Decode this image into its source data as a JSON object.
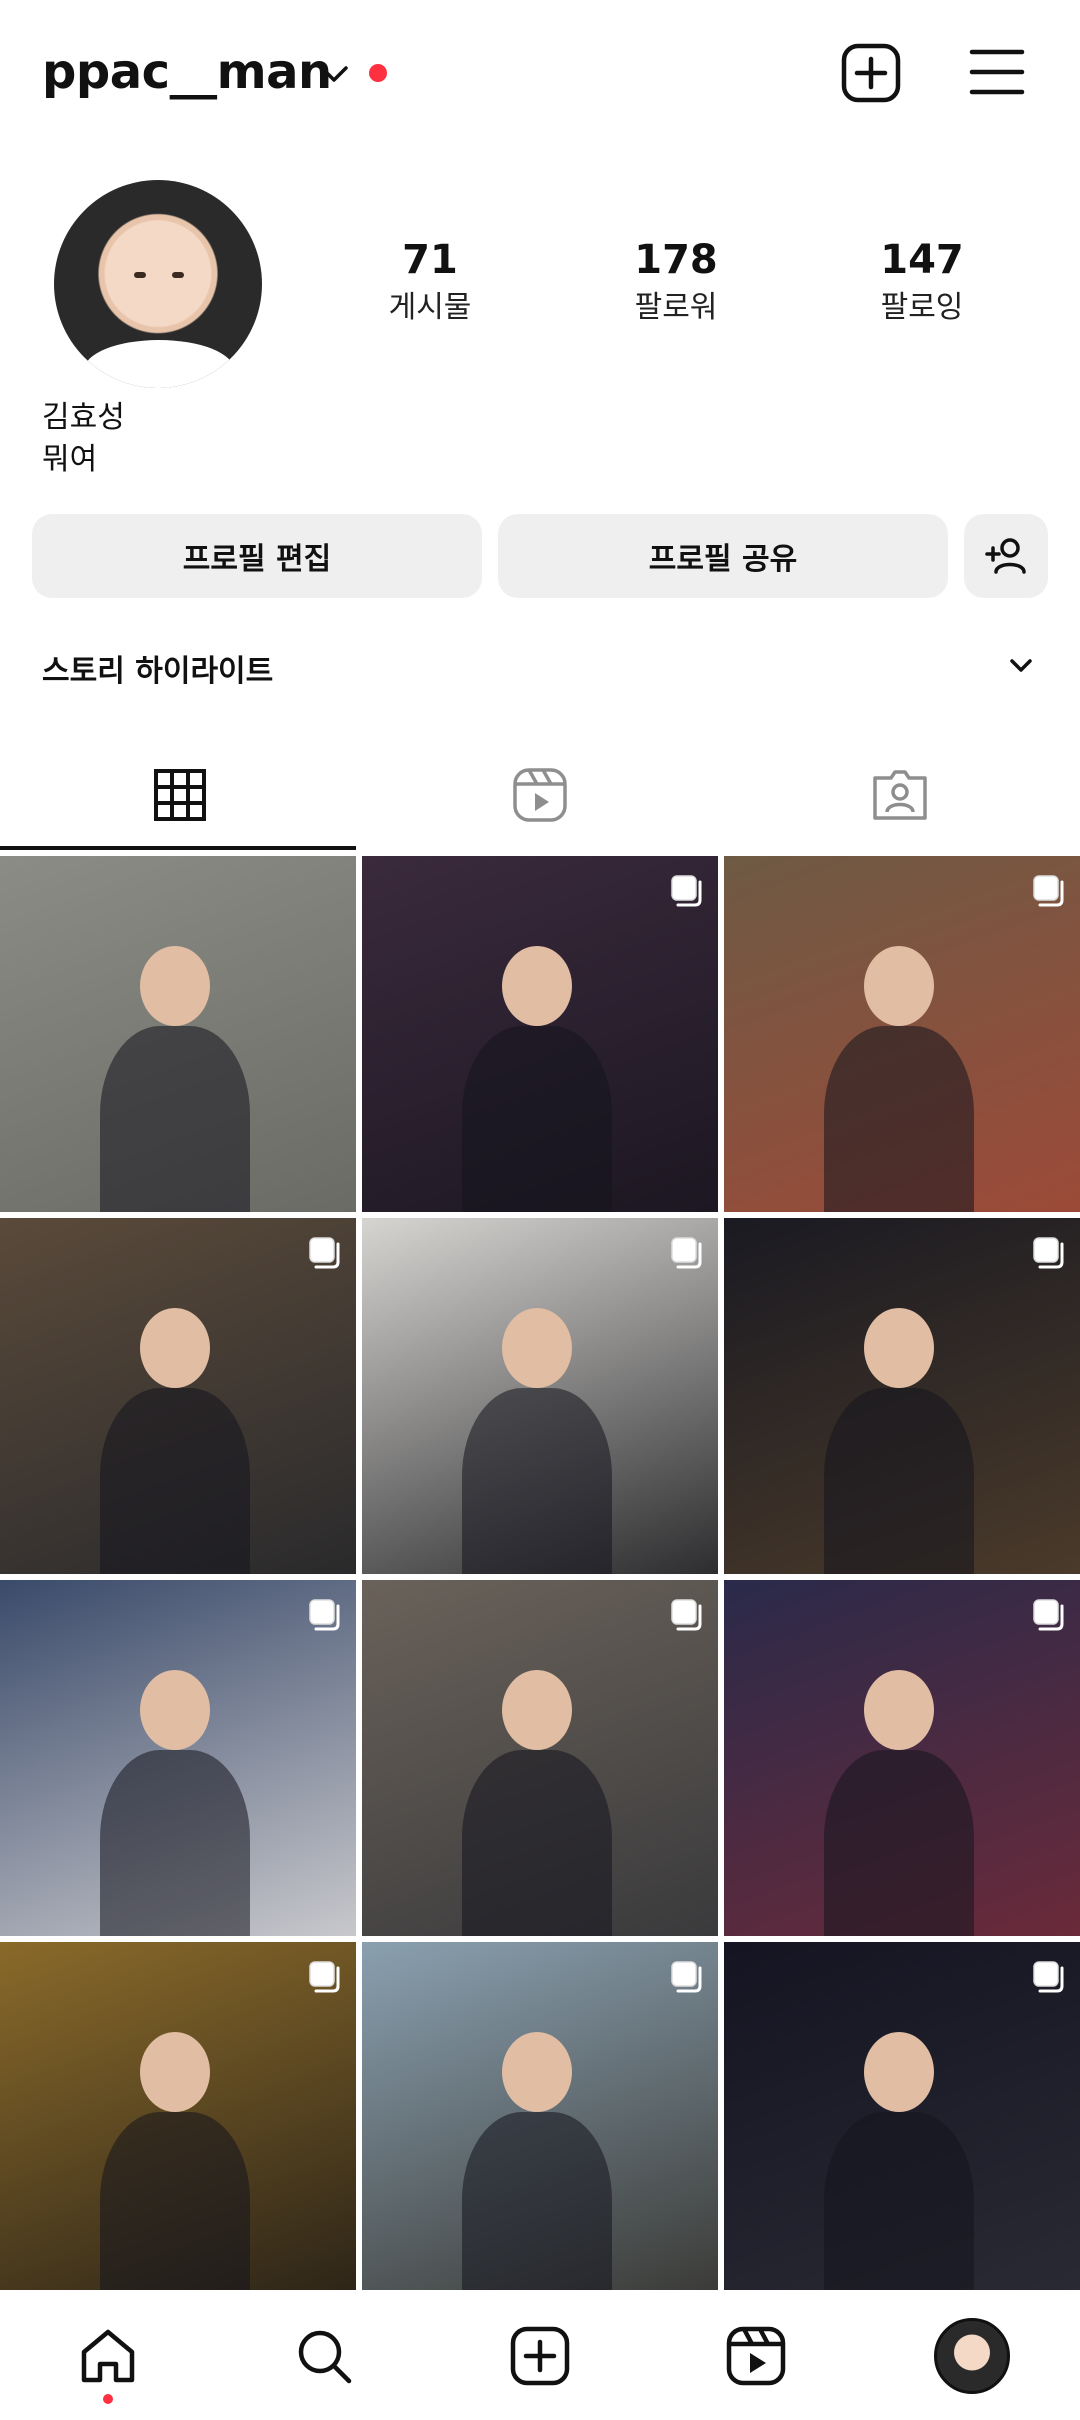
{
  "header": {
    "username": "ppac__man",
    "icons": {
      "account_switch": "chevron-down-icon",
      "create": "add-square-icon",
      "menu": "hamburger-menu-icon"
    },
    "notification_dot_color": "#ff3040"
  },
  "profile": {
    "name": "김효성",
    "bio": "뭐여",
    "stats": [
      {
        "value": "71",
        "label": "게시물"
      },
      {
        "value": "178",
        "label": "팔로워"
      },
      {
        "value": "147",
        "label": "팔로잉"
      }
    ]
  },
  "actions": {
    "edit_profile": "프로필 편집",
    "share_profile": "프로필 공유",
    "discover_people_icon": "add-person-icon"
  },
  "highlights": {
    "title": "스토리 하이라이트"
  },
  "tabs": [
    {
      "name": "posts",
      "icon": "grid-icon",
      "active": true
    },
    {
      "name": "reels",
      "icon": "reels-icon",
      "active": false
    },
    {
      "name": "tagged",
      "icon": "tagged-person-icon",
      "active": false
    }
  ],
  "posts": [
    {
      "multi": false,
      "colors": [
        "#8c8c86",
        "#6b6b66"
      ]
    },
    {
      "multi": true,
      "colors": [
        "#3a2a3c",
        "#1c1722"
      ]
    },
    {
      "multi": true,
      "colors": [
        "#6e5a44",
        "#9c4a38"
      ]
    },
    {
      "multi": true,
      "colors": [
        "#5a4a3a",
        "#2a2a2c"
      ]
    },
    {
      "multi": true,
      "colors": [
        "#d7d5d2",
        "#2d2d2f"
      ]
    },
    {
      "multi": true,
      "colors": [
        "#1a1a22",
        "#4a3a2a"
      ]
    },
    {
      "multi": true,
      "colors": [
        "#3a4a6a",
        "#c8c8cc"
      ]
    },
    {
      "multi": true,
      "colors": [
        "#6a625a",
        "#3a3a3c"
      ]
    },
    {
      "multi": true,
      "colors": [
        "#2a2a4a",
        "#6a2a3a"
      ]
    },
    {
      "multi": true,
      "colors": [
        "#8a6a2a",
        "#2c2418"
      ]
    },
    {
      "multi": true,
      "colors": [
        "#8aa0b0",
        "#3a3a36"
      ]
    },
    {
      "multi": true,
      "colors": [
        "#141422",
        "#2a2a34"
      ]
    }
  ],
  "bottom_nav": [
    {
      "name": "home",
      "icon": "home-icon",
      "active": true
    },
    {
      "name": "search",
      "icon": "search-icon",
      "active": false
    },
    {
      "name": "create",
      "icon": "add-square-icon",
      "active": false
    },
    {
      "name": "reels",
      "icon": "reels-icon",
      "active": false
    },
    {
      "name": "profile",
      "icon": "profile-avatar",
      "active": false
    }
  ]
}
